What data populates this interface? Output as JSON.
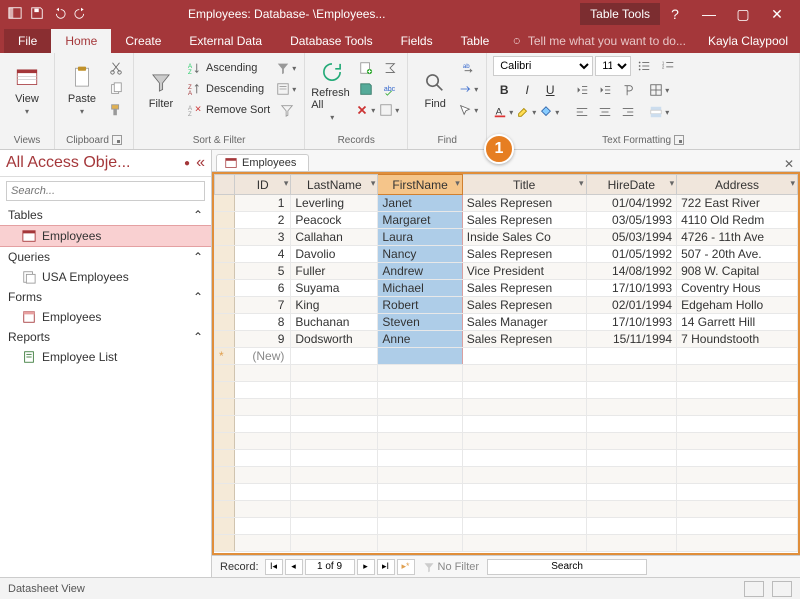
{
  "app": {
    "title": "Employees: Database- \\Employees...",
    "context_tab": "Table Tools",
    "user": "Kayla Claypool",
    "tell_me": "Tell me what you want to do..."
  },
  "tabs": [
    "File",
    "Home",
    "Create",
    "External Data",
    "Database Tools",
    "Fields",
    "Table"
  ],
  "active_tab": "Home",
  "ribbon": {
    "views": {
      "label": "Views",
      "view": "View"
    },
    "clipboard": {
      "label": "Clipboard",
      "paste": "Paste"
    },
    "sortfilter": {
      "label": "Sort & Filter",
      "filter": "Filter",
      "asc": "Ascending",
      "desc": "Descending",
      "remove": "Remove Sort"
    },
    "records": {
      "label": "Records",
      "refresh": "Refresh All"
    },
    "find": {
      "label": "Find",
      "find": "Find"
    },
    "textfmt": {
      "label": "Text Formatting",
      "font": "Calibri",
      "size": "11"
    }
  },
  "nav": {
    "title": "All Access Obje...",
    "search_placeholder": "Search...",
    "groups": [
      {
        "name": "Tables",
        "items": [
          {
            "label": "Employees",
            "icon": "table",
            "selected": true
          }
        ]
      },
      {
        "name": "Queries",
        "items": [
          {
            "label": "USA Employees",
            "icon": "query"
          }
        ]
      },
      {
        "name": "Forms",
        "items": [
          {
            "label": "Employees",
            "icon": "form"
          }
        ]
      },
      {
        "name": "Reports",
        "items": [
          {
            "label": "Employee List",
            "icon": "report"
          }
        ]
      }
    ]
  },
  "doc_tab": "Employees",
  "columns": [
    "ID",
    "LastName",
    "FirstName",
    "Title",
    "HireDate",
    "Address"
  ],
  "selected_column": "FirstName",
  "rows": [
    {
      "id": "1",
      "last": "Leverling",
      "first": "Janet",
      "title": "Sales Represen",
      "hire": "01/04/1992",
      "addr": "722 East River "
    },
    {
      "id": "2",
      "last": "Peacock",
      "first": "Margaret",
      "title": "Sales Represen",
      "hire": "03/05/1993",
      "addr": "4110 Old Redm"
    },
    {
      "id": "3",
      "last": "Callahan",
      "first": "Laura",
      "title": "Inside Sales Co",
      "hire": "05/03/1994",
      "addr": "4726 - 11th Ave"
    },
    {
      "id": "4",
      "last": "Davolio",
      "first": "Nancy",
      "title": "Sales Represen",
      "hire": "01/05/1992",
      "addr": "507 - 20th Ave."
    },
    {
      "id": "5",
      "last": "Fuller",
      "first": "Andrew",
      "title": "Vice President",
      "hire": "14/08/1992",
      "addr": "908 W. Capital "
    },
    {
      "id": "6",
      "last": "Suyama",
      "first": "Michael",
      "title": "Sales Represen",
      "hire": "17/10/1993",
      "addr": "Coventry Hous"
    },
    {
      "id": "7",
      "last": "King",
      "first": "Robert",
      "title": "Sales Represen",
      "hire": "02/01/1994",
      "addr": "Edgeham Hollo"
    },
    {
      "id": "8",
      "last": "Buchanan",
      "first": "Steven",
      "title": "Sales Manager",
      "hire": "17/10/1993",
      "addr": "14 Garrett Hill"
    },
    {
      "id": "9",
      "last": "Dodsworth",
      "first": "Anne",
      "title": "Sales Represen",
      "hire": "15/11/1994",
      "addr": "7 Houndstooth"
    }
  ],
  "new_row_label": "(New)",
  "recnav": {
    "label": "Record:",
    "pos": "1 of 9",
    "nofilter": "No Filter",
    "search": "Search"
  },
  "status": "Datasheet View",
  "callouts": {
    "c1": "1"
  }
}
